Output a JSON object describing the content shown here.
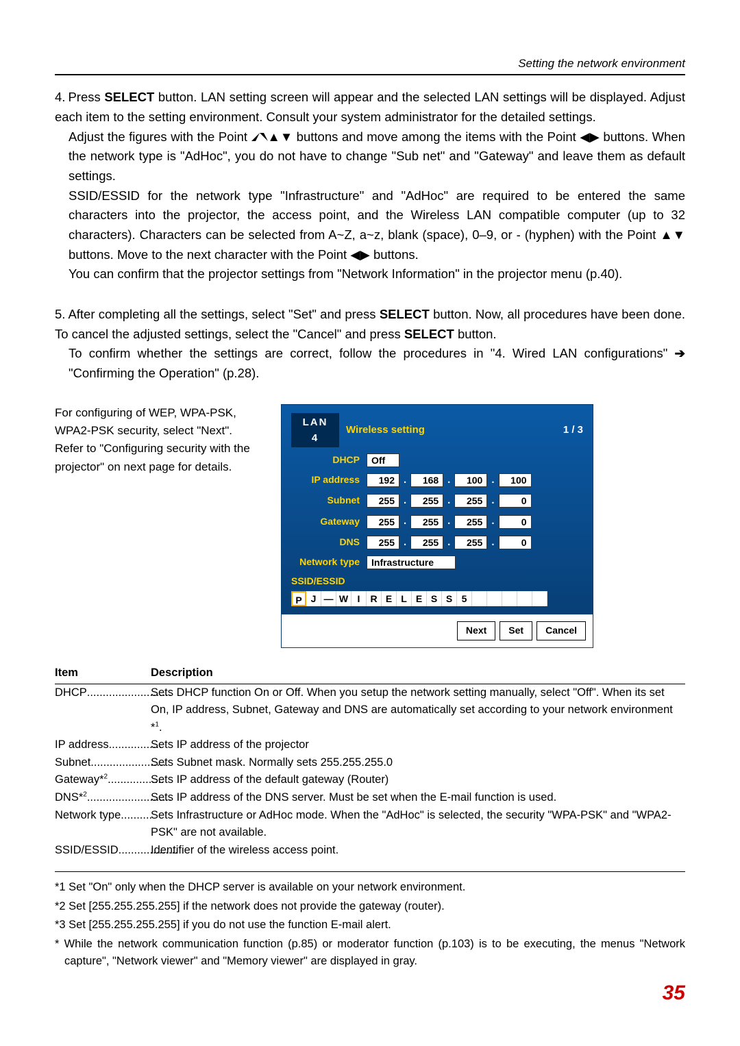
{
  "header": "Setting  the network environment",
  "step4": {
    "num": "4.",
    "p1_a": "Press ",
    "p1_b": "SELECT",
    "p1_c": " button. LAN setting screen will appear and the selected LAN settings will be displayed. Adjust each item to the setting environment. Consult your system administrator for the detailed settings.",
    "p2_a": "Adjust the figures with the Point ",
    "p2_b": " buttons and move among the items with the Point ",
    "p2_c": " buttons. When the network type is \"AdHoc\", you do not have to change \"Sub net\" and \"Gateway\" and leave them as default settings.",
    "p3": "SSID/ESSID for the network type \"Infrastructure\" and \"AdHoc\" are required to be entered the same characters into the projector, the access point, and the Wireless LAN compatible computer (up to 32 characters). Characters can be selected from A~Z, a~z, blank (space), 0–9, or - (hyphen) with the Point ",
    "p3_b": " buttons. Move to the next character with the Point ",
    "p3_c": " buttons.",
    "p4": "You can confirm that the projector settings from \"Network Information\" in the projector menu (p.40)."
  },
  "step5": {
    "num": "5.",
    "p1_a": "After completing all the settings, select \"Set\" and press ",
    "p1_b": "SELECT",
    "p1_c": " button. Now, all procedures have been done. To cancel the adjusted settings, select the \"Cancel\" and press ",
    "p1_d": "SELECT",
    "p1_e": " button.",
    "p2_a": "To confirm whether the settings are correct, follow the procedures in \"4. Wired LAN configurations\" ",
    "p2_b": " \"Confirming the Operation\" (p.28)."
  },
  "side_note": "For configuring of WEP, WPA-PSK, WPA2-PSK security, select \"Next\". Refer to  \"Configuring security with the projector\" on next page for details.",
  "screen": {
    "lan": "LAN 4",
    "title": "Wireless setting",
    "page": "1 / 3",
    "dhcp_label": "DHCP",
    "dhcp_val": "Off",
    "ip_label": "IP address",
    "ip": [
      "192",
      "168",
      "100",
      "100"
    ],
    "subnet_label": "Subnet",
    "subnet": [
      "255",
      "255",
      "255",
      "0"
    ],
    "gateway_label": "Gateway",
    "gateway": [
      "255",
      "255",
      "255",
      "0"
    ],
    "dns_label": "DNS",
    "dns": [
      "255",
      "255",
      "255",
      "0"
    ],
    "nettype_label": "Network type",
    "nettype_val": "Infrastructure",
    "ssid_label": "SSID/ESSID",
    "ssid_chars": [
      "P",
      "J",
      "—",
      "W",
      "I",
      "R",
      "E",
      "L",
      "E",
      "S",
      "S",
      "5",
      "",
      "",
      "",
      "",
      ""
    ],
    "btn_next": "Next",
    "btn_set": "Set",
    "btn_cancel": "Cancel"
  },
  "table": {
    "h_item": "Item",
    "h_desc": "Description",
    "rows": [
      {
        "item": "DHCP",
        "dots": "...........................",
        "desc": "Sets DHCP function On or Off. When you setup the network setting manually, select \"Off\". When its set On, IP address, Subnet, Gateway and DNS are automatically set according to your network environment *",
        "sup": "1",
        "tail": "."
      },
      {
        "item": "IP address",
        "dots": ".................",
        "desc": "Sets IP address of the projector"
      },
      {
        "item": "Subnet",
        "dots": "........................",
        "desc": "Sets Subnet mask. Normally sets 255.255.255.0"
      },
      {
        "item": "Gateway*",
        "sup_item": "2",
        "dots": "..................",
        "desc": "Sets IP address of the default gateway (Router)"
      },
      {
        "item": "DNS*",
        "sup_item": "2",
        "dots": "...........................",
        "desc": "Sets IP address of the DNS server. Must be set when the E-mail function is used."
      },
      {
        "item": "Network type",
        "dots": "..........",
        "desc": "Sets Infrastructure or AdHoc mode. When the \"AdHoc\" is selected, the security \"WPA-PSK\" and \"WPA2-PSK\" are not available."
      },
      {
        "item": "SSID/ESSID",
        "dots": "...................",
        "desc": "Identifier of the wireless access point."
      }
    ]
  },
  "footnotes": {
    "f1": "*1 Set \"On\" only when the DHCP server is available on your network environment.",
    "f2": "*2 Set [255.255.255.255] if the network does not provide the gateway (router).",
    "f3": "*3 Set [255.255.255.255] if you do not use the function E-mail alert.",
    "f4": "* While the network communication function (p.85) or moderator function (p.103) is to be executing, the menus \"Network capture\", \"Network viewer\" and \"Memory viewer\" are displayed in gray."
  },
  "page_number": "35"
}
